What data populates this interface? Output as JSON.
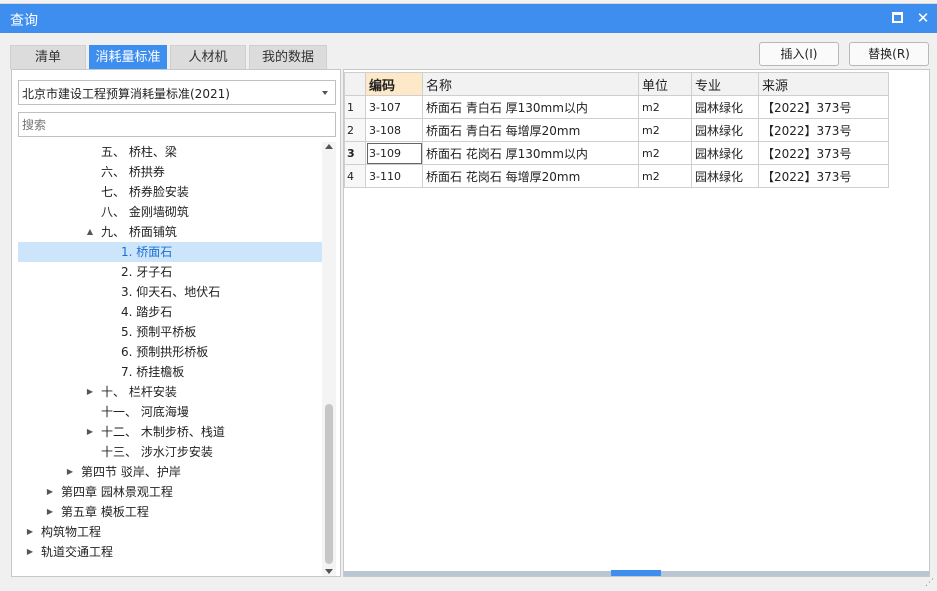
{
  "window": {
    "title": "查询"
  },
  "tabs": [
    {
      "label": "清单",
      "active": false
    },
    {
      "label": "消耗量标准",
      "active": true
    },
    {
      "label": "人材机",
      "active": false
    },
    {
      "label": "我的数据",
      "active": false
    }
  ],
  "actions": {
    "insert_label": "插入(I)",
    "replace_label": "替换(R)"
  },
  "standard_select": {
    "value": "北京市建设工程预算消耗量标准(2021)"
  },
  "search": {
    "placeholder": "搜索"
  },
  "tree": [
    {
      "label": "五、 桥柱、梁",
      "expander": "",
      "selected": false
    },
    {
      "label": "六、 桥拱券",
      "expander": "",
      "selected": false
    },
    {
      "label": "七、 桥券脸安装",
      "expander": "",
      "selected": false
    },
    {
      "label": "八、 金刚墙砌筑",
      "expander": "",
      "selected": false
    },
    {
      "label": "九、 桥面铺筑",
      "expander": "▲",
      "selected": false
    },
    {
      "label": "1. 桥面石",
      "expander": "",
      "selected": true
    },
    {
      "label": "2. 牙子石",
      "expander": "",
      "selected": false
    },
    {
      "label": "3. 仰天石、地伏石",
      "expander": "",
      "selected": false
    },
    {
      "label": "4. 踏步石",
      "expander": "",
      "selected": false
    },
    {
      "label": "5. 预制平桥板",
      "expander": "",
      "selected": false
    },
    {
      "label": "6. 预制拱形桥板",
      "expander": "",
      "selected": false
    },
    {
      "label": "7. 桥挂檐板",
      "expander": "",
      "selected": false
    },
    {
      "label": "十、 栏杆安装",
      "expander": "▶",
      "selected": false
    },
    {
      "label": "十一、 河底海墁",
      "expander": "",
      "selected": false
    },
    {
      "label": "十二、 木制步桥、栈道",
      "expander": "▶",
      "selected": false
    },
    {
      "label": "十三、 涉水汀步安装",
      "expander": "",
      "selected": false
    },
    {
      "label": "第四节 驳岸、护岸",
      "expander": "▶",
      "selected": false
    },
    {
      "label": "第四章 园林景观工程",
      "expander": "▶",
      "selected": false
    },
    {
      "label": "第五章 模板工程",
      "expander": "▶",
      "selected": false
    },
    {
      "label": "构筑物工程",
      "expander": "▶",
      "selected": false
    },
    {
      "label": "轨道交通工程",
      "expander": "▶",
      "selected": false
    }
  ],
  "grid": {
    "columns": [
      "编码",
      "名称",
      "单位",
      "专业",
      "来源"
    ],
    "rows": [
      {
        "num": "1",
        "code": "3-107",
        "name": "桥面石 青白石 厚130mm以内",
        "unit": "m2",
        "major": "园林绿化",
        "source": "【2022】373号"
      },
      {
        "num": "2",
        "code": "3-108",
        "name": "桥面石 青白石 每增厚20mm",
        "unit": "m2",
        "major": "园林绿化",
        "source": "【2022】373号"
      },
      {
        "num": "3",
        "code": "3-109",
        "name": "桥面石 花岗石 厚130mm以内",
        "unit": "m2",
        "major": "园林绿化",
        "source": "【2022】373号"
      },
      {
        "num": "4",
        "code": "3-110",
        "name": "桥面石 花岗石 每增厚20mm",
        "unit": "m2",
        "major": "园林绿化",
        "source": "【2022】373号"
      }
    ]
  },
  "colors": {
    "accent": "#3e8ef0",
    "selection": "#cde5fb",
    "sorted_header": "#fde8c8"
  }
}
